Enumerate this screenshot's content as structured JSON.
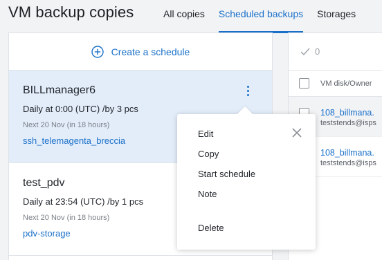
{
  "header": {
    "title": "VM backup copies",
    "tabs": [
      {
        "label": "All copies",
        "active": false
      },
      {
        "label": "Scheduled backups",
        "active": true
      },
      {
        "label": "Storages",
        "active": false
      }
    ]
  },
  "left_panel": {
    "create_label": "Create a schedule",
    "schedules": [
      {
        "name": "BILLmanager6",
        "description": "Daily at 0:00 (UTC) /by 3 pcs",
        "next_run": "Next 20 Nov (in 18 hours)",
        "storage": "ssh_telemagenta_breccia"
      },
      {
        "name": "test_pdv",
        "description": "Daily at 23:54 (UTC) /by 1 pcs",
        "next_run": "Next 20 Nov (in 18 hours)",
        "storage": "pdv-storage"
      }
    ]
  },
  "right_panel": {
    "selected_count": "0",
    "column_header": "VM disk/Owner",
    "rows": [
      {
        "disk": "108_billmana.",
        "owner": "teststends@isps"
      },
      {
        "disk": "108_billmana.",
        "owner": "teststends@isps"
      }
    ]
  },
  "context_menu": {
    "items": [
      "Edit",
      "Copy",
      "Start schedule",
      "Note",
      "Delete"
    ]
  },
  "colors": {
    "accent": "#1a70c9",
    "selected_bg": "#e3edfa",
    "page_bg": "#f2f3f5"
  }
}
